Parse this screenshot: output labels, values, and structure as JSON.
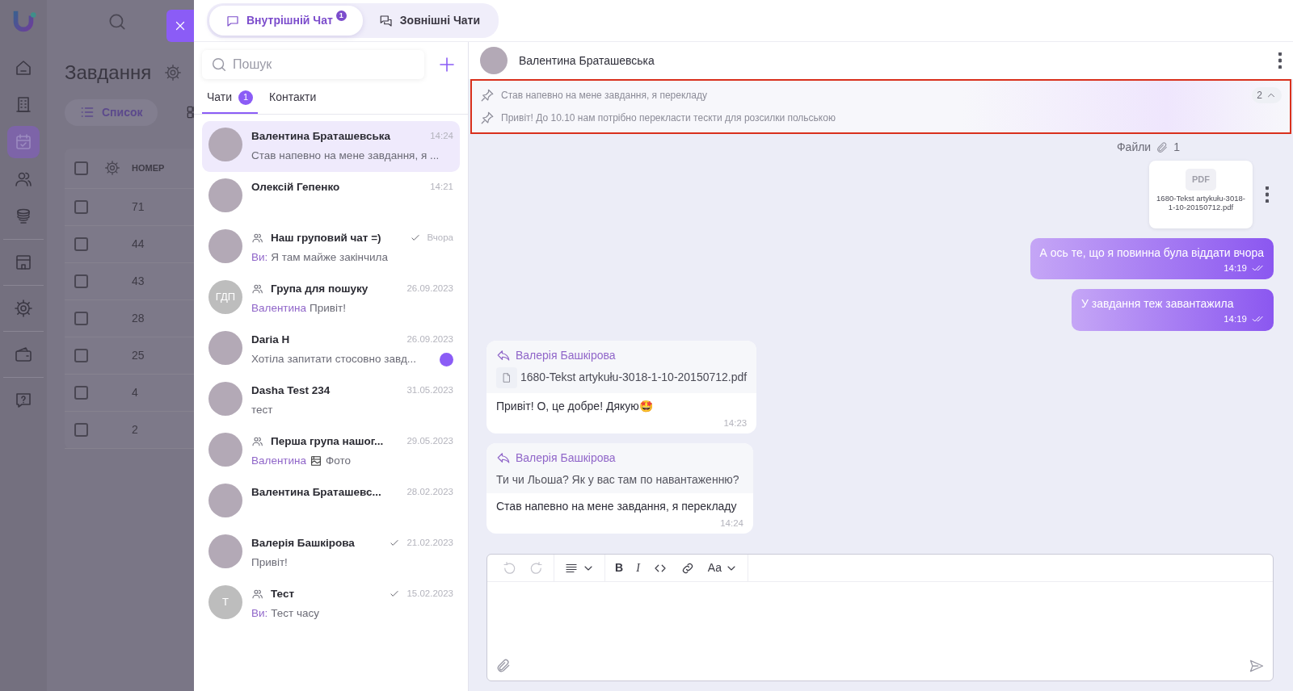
{
  "app_rail": {
    "groups": [
      [
        {
          "kind": "home",
          "selected": false
        },
        {
          "kind": "building",
          "selected": false
        },
        {
          "kind": "calendar",
          "selected": true
        },
        {
          "kind": "people",
          "selected": false
        },
        {
          "kind": "database",
          "selected": false
        }
      ],
      [
        {
          "kind": "store",
          "selected": false
        }
      ],
      [
        {
          "kind": "gear",
          "selected": false
        }
      ],
      [
        {
          "kind": "wallet",
          "selected": false
        }
      ],
      [
        {
          "kind": "help",
          "selected": false
        }
      ]
    ]
  },
  "background_page": {
    "title": "Завдання",
    "view_tabs": [
      {
        "kind": "list",
        "label": "Список",
        "selected": true
      },
      {
        "kind": "grid",
        "selected": false
      }
    ],
    "table": {
      "columns": [
        "НОМЕР"
      ],
      "all_checked": false,
      "rows": [
        {
          "cells": [
            "71"
          ],
          "checked": false
        },
        {
          "cells": [
            "44"
          ],
          "checked": false
        },
        {
          "cells": [
            "43"
          ],
          "checked": false
        },
        {
          "cells": [
            "28"
          ],
          "checked": false
        },
        {
          "cells": [
            "25"
          ],
          "checked": false
        },
        {
          "cells": [
            "4"
          ],
          "checked": false
        },
        {
          "cells": [
            "2"
          ],
          "checked": false
        }
      ]
    }
  },
  "chat_panel": {
    "tabs": [
      {
        "kind": "internal",
        "label": "Внутрішній Чат",
        "badge": "1",
        "selected": true
      },
      {
        "kind": "external",
        "label": "Зовнішні Чати",
        "selected": false
      }
    ],
    "search": {
      "placeholder": "Пошук"
    },
    "list_tabs": [
      {
        "label": "Чати",
        "badge": "1",
        "selected": true
      },
      {
        "label": "Контакти",
        "selected": false
      }
    ],
    "chats": [
      {
        "avatar": {
          "kind": "photo"
        },
        "group": false,
        "name": "Валентина Браташевська",
        "time": "14:24",
        "sent_check": false,
        "preview": "Став напевно на мене завдання, я ...",
        "unread": false,
        "selected": true
      },
      {
        "avatar": {
          "kind": "photo"
        },
        "group": false,
        "name": "Олексій Гепенко",
        "time": "14:21",
        "sent_check": false,
        "unread": false,
        "selected": false
      },
      {
        "avatar": {
          "kind": "photo"
        },
        "group": true,
        "name": "Наш груповий чат =)",
        "time": "Вчора",
        "sent_check": true,
        "sender": "Ви:",
        "preview": "Я там майже закінчила",
        "unread": false,
        "selected": false
      },
      {
        "avatar": {
          "kind": "initials",
          "text": "ГДП"
        },
        "group": true,
        "name": "Група для пошуку",
        "time": "26.09.2023",
        "sent_check": false,
        "sender": "Валентина",
        "preview": "Привіт!",
        "unread": false,
        "selected": false
      },
      {
        "avatar": {
          "kind": "photo"
        },
        "group": false,
        "name": "Daria H",
        "time": "26.09.2023",
        "sent_check": false,
        "preview": "Хотіла запитати стосовно завд...",
        "unread": true,
        "selected": false
      },
      {
        "avatar": {
          "kind": "photo"
        },
        "group": false,
        "name": "Dasha Test 234",
        "time": "31.05.2023",
        "sent_check": false,
        "preview": "тест",
        "unread": false,
        "selected": false
      },
      {
        "avatar": {
          "kind": "photo"
        },
        "group": true,
        "name": "Перша група нашог...",
        "time": "29.05.2023",
        "sent_check": false,
        "sender": "Валентина",
        "photo": true,
        "preview": "Фото",
        "unread": false,
        "selected": false
      },
      {
        "avatar": {
          "kind": "photo"
        },
        "group": false,
        "name": "Валентина Браташевс...",
        "time": "28.02.2023",
        "sent_check": false,
        "unread": false,
        "selected": false
      },
      {
        "avatar": {
          "kind": "photo"
        },
        "group": false,
        "name": "Валерія Башкірова",
        "time": "21.02.2023",
        "sent_check": true,
        "preview": "Привіт!",
        "unread": false,
        "selected": false
      },
      {
        "avatar": {
          "kind": "initials",
          "text": "Т"
        },
        "group": true,
        "name": "Тест",
        "time": "15.02.2023",
        "sent_check": true,
        "sender": "Ви:",
        "preview": "Тест часу",
        "unread": false,
        "selected": false
      }
    ]
  },
  "conversation": {
    "name": "Валентина Браташевська",
    "pinned": {
      "highlighted": true,
      "count": "2",
      "expanded": true,
      "items": [
        "Став напевно на мене завдання, я перекладу",
        "Привіт! До 10.10 нам потрібно перекласти тескти для розсилки польською"
      ]
    },
    "files": {
      "label": "Файли",
      "count": "1",
      "items": [
        {
          "type": "PDF",
          "name": "1680-Tekst artykułu-3018-1-10-20150712.pdf"
        }
      ]
    },
    "messages": [
      {
        "kind": "outgoing",
        "text": "А ось те, що я повинна була віддати вчора",
        "time": "14:19",
        "read": true
      },
      {
        "kind": "outgoing",
        "text": "У завдання теж завантажила",
        "time": "14:19",
        "read": true
      },
      {
        "kind": "incoming",
        "reply": {
          "author": "Валерія Башкірова",
          "kind": "file",
          "text": "1680-Tekst artykułu-3018-1-10-20150712.pdf"
        },
        "text": "Привіт! О, це добре! Дякую🤩",
        "time": "14:23"
      },
      {
        "kind": "incoming",
        "reply": {
          "author": "Валерія Башкірова",
          "kind": "text",
          "text": "Ти чи Льоша? Як у вас там по навантаженню?"
        },
        "text": "Став напевно на мене завдання, я перекладу",
        "time": "14:24"
      }
    ],
    "composer": {
      "groups": [
        [
          {
            "kind": "undo",
            "disabled": true
          },
          {
            "kind": "redo",
            "disabled": true
          }
        ],
        [
          {
            "kind": "align",
            "dropdown": true,
            "disabled": false
          }
        ],
        [
          {
            "kind": "bold",
            "label": "B",
            "disabled": false
          },
          {
            "kind": "italic",
            "label": "I",
            "disabled": false
          },
          {
            "kind": "code",
            "disabled": false
          },
          {
            "kind": "link",
            "disabled": false
          },
          {
            "kind": "font",
            "label": "Aa",
            "dropdown": true,
            "disabled": false
          }
        ]
      ]
    }
  }
}
